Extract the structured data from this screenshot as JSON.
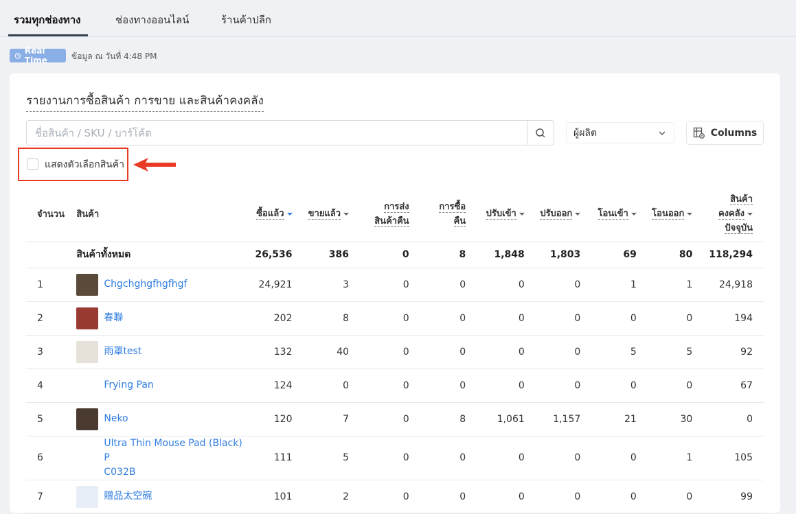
{
  "tabs": [
    {
      "label": "รวมทุกช่องทาง",
      "active": true
    },
    {
      "label": "ช่องทางออนไลน์",
      "active": false
    },
    {
      "label": "ร้านค้าปลีก",
      "active": false
    }
  ],
  "realtime": {
    "badge": "Real Time",
    "time_text": "ข้อมูล ณ วันที่ 4:48 PM"
  },
  "report": {
    "title": "รายงานการซื้อสินค้า การขาย และสินค้าคงคลัง",
    "search_placeholder": "ชื่อสินค้า / SKU / บาร์โค้ด",
    "manufacturer_label": "ผู้ผลิต",
    "columns_label": "Columns",
    "show_option_label": "แสดงตัวเลือกสินค้า"
  },
  "table": {
    "headers": {
      "index": "จำนวน",
      "product": "สินค้า",
      "purchased": "ซื้อแล้ว",
      "sold": "ขายแล้ว",
      "return_ship_1": "การส่ง",
      "return_ship_2": "สินค้าคืน",
      "buy_return_1": "การซื้อ",
      "buy_return_2": "คืน",
      "adj_in": "ปรับเข้า",
      "adj_out": "ปรับออก",
      "transfer_in": "โอนเข้า",
      "transfer_out": "โอนออก",
      "stock_1": "สินค้า",
      "stock_2": "คงคลัง",
      "stock_3": "ปัจจุบัน"
    },
    "total": {
      "label": "สินค้าทั้งหมด",
      "values": [
        "26,536",
        "386",
        "0",
        "8",
        "1,848",
        "1,803",
        "69",
        "80",
        "118,294"
      ]
    },
    "rows": [
      {
        "idx": "1",
        "name": "Chgchghgfhgfhgf",
        "thumb": "#5a4a3a",
        "values": [
          "24,921",
          "3",
          "0",
          "0",
          "0",
          "0",
          "1",
          "1",
          "24,918"
        ]
      },
      {
        "idx": "2",
        "name": "春聯",
        "thumb": "#9a3b33",
        "values": [
          "202",
          "8",
          "0",
          "0",
          "0",
          "0",
          "0",
          "0",
          "194"
        ]
      },
      {
        "idx": "3",
        "name": "雨罩test",
        "thumb": "#e6e2da",
        "values": [
          "132",
          "40",
          "0",
          "0",
          "0",
          "0",
          "5",
          "5",
          "92"
        ]
      },
      {
        "idx": "4",
        "name": "Frying Pan",
        "thumb": "#ffffff",
        "values": [
          "124",
          "0",
          "0",
          "0",
          "0",
          "0",
          "0",
          "0",
          "67"
        ]
      },
      {
        "idx": "5",
        "name": "Neko",
        "thumb": "#4a3a30",
        "values": [
          "120",
          "7",
          "0",
          "8",
          "1,061",
          "1,157",
          "21",
          "30",
          "0"
        ]
      },
      {
        "idx": "6",
        "name_line1": "Ultra Thin Mouse Pad (Black) P",
        "name_line2": "C032B",
        "thumb": "#ffffff",
        "values": [
          "111",
          "5",
          "0",
          "0",
          "0",
          "0",
          "0",
          "1",
          "105"
        ]
      },
      {
        "idx": "7",
        "name": "贈品太空碗",
        "thumb": "#e8eef8",
        "values": [
          "101",
          "2",
          "0",
          "0",
          "0",
          "0",
          "0",
          "0",
          "99"
        ]
      }
    ]
  }
}
